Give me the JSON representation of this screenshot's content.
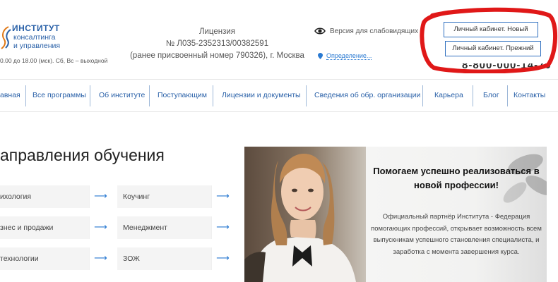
{
  "header": {
    "logo": {
      "title": "ИНСТИТУТ",
      "line1": "консалтинга",
      "line2": "и управления"
    },
    "hours": "0.00 до 18.00 (мск). Сб, Вс – выходной",
    "license": {
      "line1": "Лицензия",
      "line2": "№ Л035-2352313/00382591",
      "line3": "(ранее присвоенный номер 790326), г. Москва"
    },
    "vision_label": "Версия для слабовидящих",
    "geo_label": "Определение...",
    "cabinet_new": "Личный кабинет. Новый",
    "cabinet_old": "Личный кабинет. Прежний",
    "phone": "8-800-000-14-70"
  },
  "nav": {
    "items": [
      {
        "label": "авная"
      },
      {
        "label": "Все программы"
      },
      {
        "label": "Об институте"
      },
      {
        "label": "Поступающим"
      },
      {
        "label": "Лицензии и документы"
      },
      {
        "label": "Сведения об обр. организации"
      },
      {
        "label": "Карьера"
      },
      {
        "label": "Блог"
      },
      {
        "label": "Контакты"
      }
    ]
  },
  "directions": {
    "title": "аправления обучения",
    "arrow": "⟶",
    "items": [
      {
        "label": "ихология"
      },
      {
        "label": "Коучинг"
      },
      {
        "label": "знес и продажи"
      },
      {
        "label": "Менеджмент"
      },
      {
        "label": "технологии"
      },
      {
        "label": "ЗОЖ"
      }
    ]
  },
  "banner": {
    "title": "Помогаем успешно реализоваться в новой профессии!",
    "text": "Официальный партнёр Института - Федерация помогающих профессий, открывает возможность всем выпускникам успешного становления специалиста, и заработка с момента завершения курса."
  },
  "colors": {
    "brand_blue": "#2a61a8",
    "link_blue": "#2a7ad2",
    "annotation_red": "#e01818"
  }
}
